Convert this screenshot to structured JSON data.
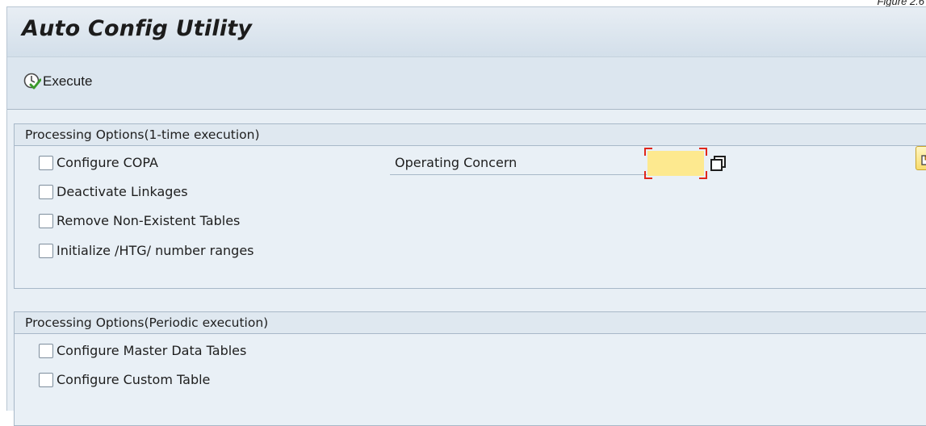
{
  "caption": "Figure 2.6",
  "app": {
    "title": "Auto Config Utility"
  },
  "toolbar": {
    "execute_label": "Execute"
  },
  "group1": {
    "header": "Processing Options(1-time execution)",
    "checkboxes": [
      "Configure COPA",
      "Deactivate Linkages",
      "Remove Non-Existent Tables",
      "Initialize /HTG/ number ranges"
    ],
    "operating_concern": {
      "label": "Operating Concern",
      "value": ""
    }
  },
  "group2": {
    "header": "Processing Options(Periodic execution)",
    "checkboxes": [
      "Configure Master Data Tables",
      "Configure Custom Table"
    ]
  },
  "colors": {
    "required_input_bg": "#fde98f",
    "required_marker": "#e0271b",
    "header_bg": "#dfe8f0",
    "nav_button_bg": "#f8dc6b"
  },
  "icons": {
    "execute": "execute-clock-check-icon",
    "value_help": "value-help-icon",
    "nav": "display-object-arrow-icon"
  }
}
